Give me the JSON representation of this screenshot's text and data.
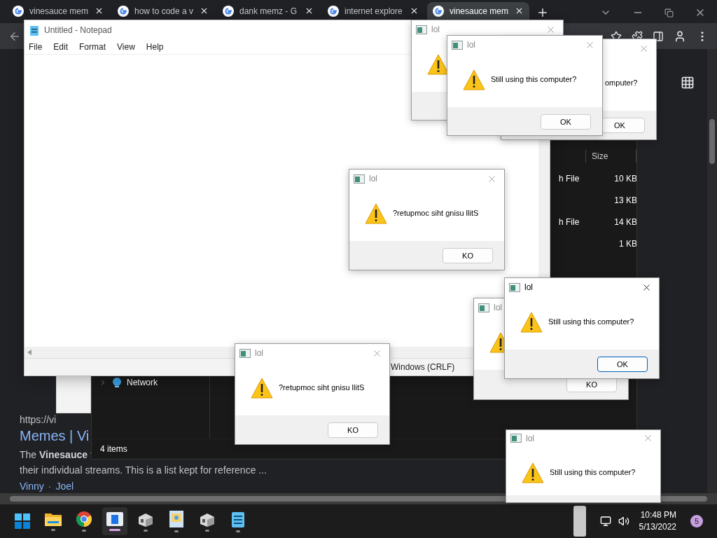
{
  "browser": {
    "tabs": [
      {
        "title": "vinesauce mem",
        "selected": false
      },
      {
        "title": "how to code a v",
        "selected": false
      },
      {
        "title": "dank memz - G",
        "selected": false
      },
      {
        "title": "internet explore",
        "selected": false
      },
      {
        "title": "vinesauce mem",
        "selected": true
      }
    ],
    "page": {
      "result": {
        "url": "https://vi",
        "title": "Memes | Vi",
        "snippet": [
          "The **Vinesauce** t",
          "their individual streams. This is a list kept for reference ..."
        ],
        "links": [
          "Vinny",
          "Joel"
        ],
        "separator": "·"
      }
    }
  },
  "explorer": {
    "columns": [
      {
        "label": "Size"
      }
    ],
    "rows": [
      {
        "type": "h File",
        "size": "10 KB"
      },
      {
        "size": "13 KB"
      },
      {
        "type": "h File",
        "size": "14 KB"
      },
      {
        "size": "1 KB"
      }
    ],
    "nav": [
      {
        "label": "Network",
        "expanded": false
      }
    ],
    "status": "4 items"
  },
  "notepad": {
    "title": "Untitled - Notepad",
    "menu": [
      "File",
      "Edit",
      "Format",
      "View",
      "Help"
    ],
    "status": [
      "Windows (CRLF)"
    ]
  },
  "dialogs": [
    {
      "title": "lol",
      "active": false
    },
    {
      "title": "lol",
      "message": "Still using this computer?",
      "button": "OK",
      "active": false
    },
    {
      "message": "omputer?",
      "button": "OK",
      "active": false
    },
    {
      "title": "lol",
      "message": "?retupmoc siht gnisu llitS",
      "button": "KO",
      "active": false
    },
    {
      "title": "lol",
      "button": "KO",
      "active": false
    },
    {
      "title": "lol",
      "message": "Still using this computer?",
      "button": "OK",
      "active": true
    },
    {
      "title": "lol",
      "message": "?retupmoc siht gnisu llitS",
      "button": "KO",
      "active": false
    },
    {
      "title": "lol",
      "message": "Still using this computer?",
      "active": false
    }
  ],
  "taskbar": {
    "apps": [
      {
        "kind": "start",
        "running": false,
        "active": false
      },
      {
        "kind": "folder",
        "running": true,
        "active": false
      },
      {
        "kind": "browser",
        "running": true,
        "active": false
      },
      {
        "kind": "window",
        "running": true,
        "active": true
      },
      {
        "kind": "program",
        "running": true,
        "active": false
      },
      {
        "kind": "paint",
        "running": true,
        "active": false
      },
      {
        "kind": "program",
        "running": true,
        "active": false
      },
      {
        "kind": "notepad",
        "running": true,
        "active": false
      }
    ],
    "time": "10:48 PM",
    "date": "5/13/2022",
    "notification_count": "5"
  }
}
